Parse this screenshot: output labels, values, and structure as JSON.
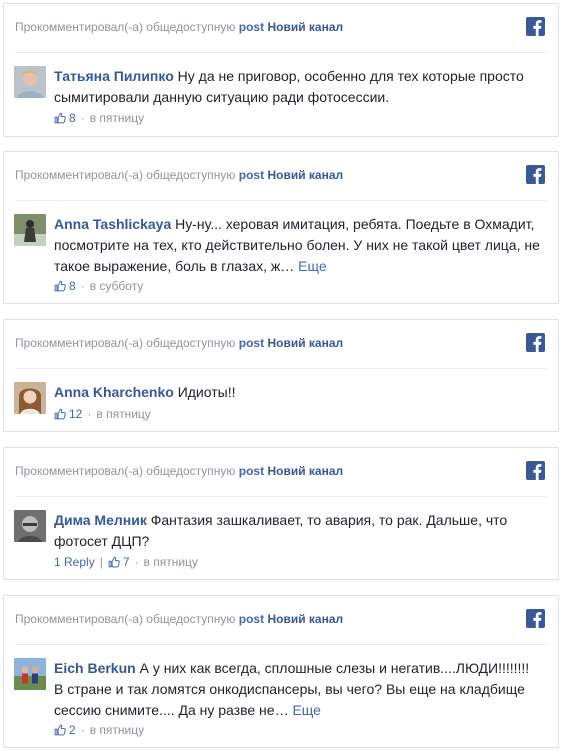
{
  "header": {
    "prefix": "Прокомментировал(-а) общедоступную",
    "post_word": "post",
    "channel": "Новий канал"
  },
  "comments": [
    {
      "author": "Татьяна Пилипко",
      "text": "Ну да не приговор, особенно для тех которые просто сымитировали данную ситуацию ради фотосессии.",
      "more": "",
      "replies": "",
      "likes": "8",
      "time": "в пятницу"
    },
    {
      "author": "Anna Tashlickaya",
      "text": "Ну-ну... херовая имитация, ребята. Поедьте в Охмадит, посмотрите на тех, кто действительно болен. У них не такой цвет лица, не такое выражение, боль в глазах, ж…",
      "more": "Еще",
      "replies": "",
      "likes": "8",
      "time": "в субботу"
    },
    {
      "author": "Anna Kharchenko",
      "text": "Идиоты!!",
      "more": "",
      "replies": "",
      "likes": "12",
      "time": "в пятницу"
    },
    {
      "author": "Дима Мелник",
      "text": "Фантазия зашкаливает, то авария, то рак. Дальше, что фотосет ДЦП?",
      "more": "",
      "replies": "1 Reply",
      "likes": "7",
      "time": "в пятницу"
    },
    {
      "author": "Eich Berkun",
      "text": "А у них как всегда, сплошные слезы и негатив....ЛЮДИ!!!!!!!! В стране и так ломятся онкодиспансеры, вы чего? Вы еще на кладбище сессию снимите.... Да ну разве не…",
      "more": "Еще",
      "replies": "",
      "likes": "2",
      "time": "в пятницу"
    }
  ],
  "colors": {
    "facebook_blue": "#3b5998",
    "link_blue": "#365899",
    "meta_gray": "#90949c"
  },
  "icons": [
    "facebook-icon",
    "thumbs-up-icon"
  ]
}
